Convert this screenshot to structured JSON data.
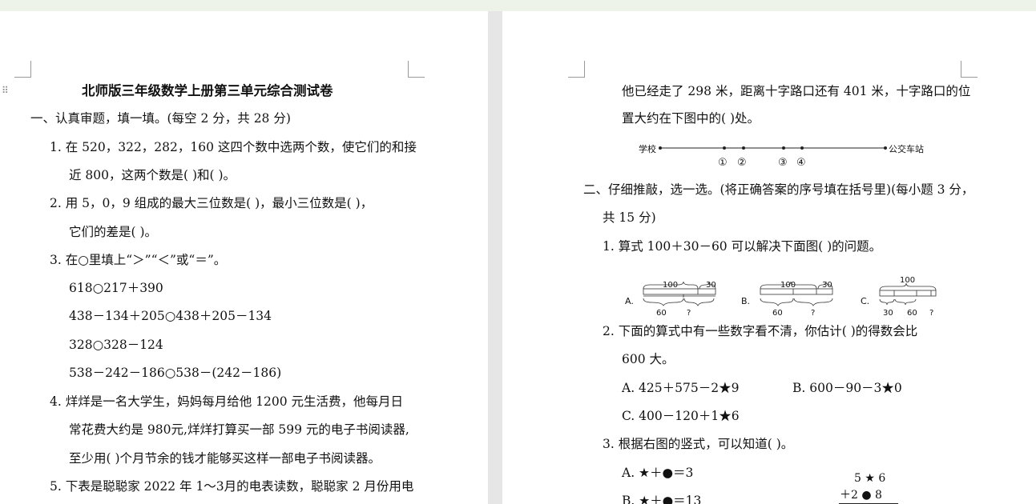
{
  "left_page": {
    "title": "北师版三年级数学上册第三单元综合测试卷",
    "section1": "一、认真审题，填一填。(每空 2 分，共 28 分)",
    "q1_a": "1.  在 520，322，282，160 这四个数中选两个数，使它们的和接",
    "q1_b": "近 800，这两个数是(      )和(      )。",
    "q2_a": "2.  用 5，0，9 组成的最大三位数是(      )，最小三位数是(      )，",
    "q2_b": "它们的差是(      )。",
    "q3_a": "3.  在○里填上“＞”“＜”或“＝”。",
    "q3_e1": "618○217＋390",
    "q3_e2": "438－134＋205○438＋205－134",
    "q3_e3": "328○328－124",
    "q3_e4": "538－242－186○538－(242－186)",
    "q4_a": "4.  烊烊是一名大学生，妈妈每月给他 1200 元生活费，他每月日",
    "q4_b": "常花费大约是 980元,烊烊打算买一部 599 元的电子书阅读器,",
    "q4_c": "至少用(      )个月节余的钱才能够买这样一部电子书阅读器。",
    "q5_a": "5.  下表是聪聪家 2022 年 1～3月的电表读数，聪聪家 2 月份用电"
  },
  "right_page": {
    "q6_a": "他已经走了 298 米，距离十字路口还有 401 米，十字路口的位",
    "q6_b": "置大约在下图中的(      )处。",
    "line_left": "学校",
    "line_right": "公交车站",
    "point_labels": [
      "①",
      "②",
      "③",
      "④"
    ],
    "section2_a": "二、仔细推敲，选一选。(将正确答案的序号填在括号里)(每小题 3 分，",
    "section2_b": "共 15 分)",
    "q1": "1.  算式 100＋30－60 可以解决下面图(      )的问题。",
    "diagramA": {
      "letter": "A.",
      "top1": "100",
      "top2": "30",
      "bot1": "60",
      "bot2": "?"
    },
    "diagramB": {
      "letter": "B.",
      "top1": "100",
      "top2": "30",
      "bot1": "60",
      "bot2": "?"
    },
    "diagramC": {
      "letter": "C.",
      "top1": "100",
      "bot1": "30",
      "bot2": "60",
      "bot3": "?"
    },
    "q2_a": "2.  下面的算式中有一些数字看不清，你估计(      )的得数会比",
    "q2_b": "600 大。",
    "q2_optA": "A.  425＋575－2★9",
    "q2_optB": "B.  600－90－3★0",
    "q2_optC": "C.  400－120＋1★6",
    "q3": "3.  根据右图的竖式，可以知道(      )。",
    "q3_optA": "A.  ★＋●＝3",
    "q3_optB": "B.  ★＋●＝13",
    "vertical_row1": "5  ★  6",
    "vertical_row2": "＋2  ●  8"
  }
}
